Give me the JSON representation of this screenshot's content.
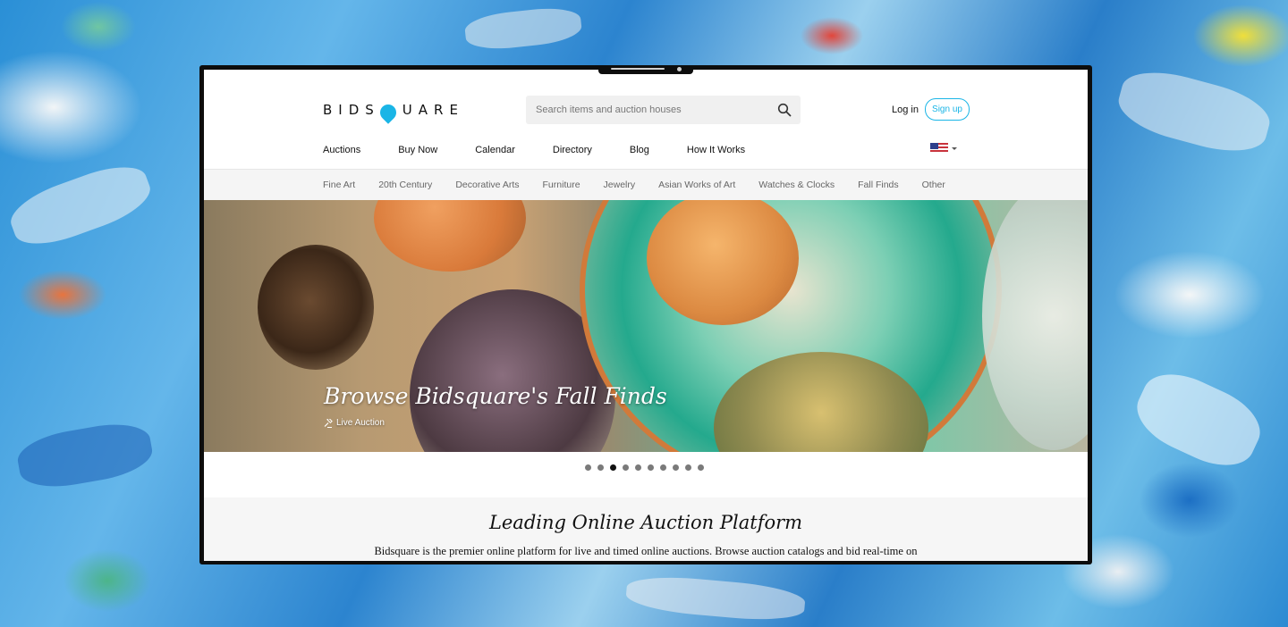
{
  "header": {
    "logo_text": "BIDSQUARE",
    "search_placeholder": "Search items and auction houses",
    "login_label": "Log in",
    "signup_label": "Sign up",
    "locale_flag": "us-flag-icon"
  },
  "main_nav": [
    "Auctions",
    "Buy Now",
    "Calendar",
    "Directory",
    "Blog",
    "How It Works"
  ],
  "categories": [
    "Fine Art",
    "20th Century",
    "Decorative Arts",
    "Furniture",
    "Jewelry",
    "Asian Works of Art",
    "Watches & Clocks",
    "Fall Finds",
    "Other"
  ],
  "hero": {
    "title": "Browse Bidsquare's Fall Finds",
    "subtitle": "Live Auction",
    "slide_count": 10,
    "active_slide": 3
  },
  "intro": {
    "title": "Leading Online Auction Platform",
    "text": "Bidsquare is the premier online platform for live and timed online auctions. Browse auction catalogs and bid real-time on"
  },
  "colors": {
    "accent": "#1ab5e6",
    "text": "#111111",
    "category_text": "#666666",
    "category_bg": "#f5f5f5"
  }
}
